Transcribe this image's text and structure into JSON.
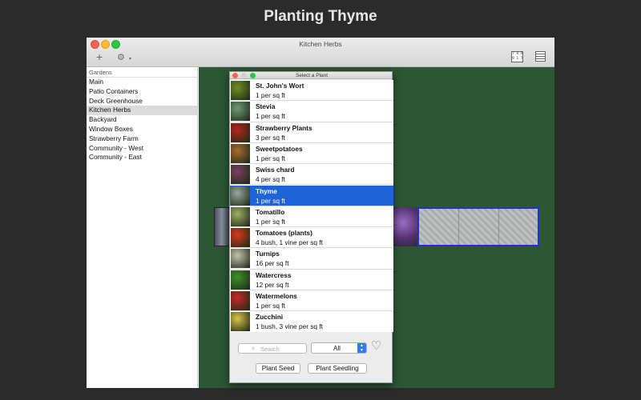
{
  "headline": "Planting Thyme",
  "window": {
    "title": "Kitchen Herbs",
    "toolbar": {
      "add_icon": "+",
      "gear_icon": "⚙",
      "gear_caret": "▾",
      "grid_icon_text": "7 4 9\n9 1 7"
    }
  },
  "sidebar": {
    "header": "Gardens",
    "items": [
      {
        "label": "Main"
      },
      {
        "label": "Patio Containers"
      },
      {
        "label": "Deck Greenhouse"
      },
      {
        "label": "Kitchen Herbs",
        "selected": true
      },
      {
        "label": "Backyard"
      },
      {
        "label": "Window Boxes"
      },
      {
        "label": "Strawberry Farm"
      },
      {
        "label": "Community - West"
      },
      {
        "label": "Community - East"
      }
    ]
  },
  "picker": {
    "title": "Select a Plant",
    "plants": [
      {
        "name": "St. John's Wort",
        "spacing": "1 per sq ft",
        "color": "#6f8e2a"
      },
      {
        "name": "Stevia",
        "spacing": "1 per sq ft",
        "color": "#6f9a78"
      },
      {
        "name": "Strawberry Plants",
        "spacing": "3 per sq ft",
        "color": "#b8241e"
      },
      {
        "name": "Sweetpotatoes",
        "spacing": "1 per sq ft",
        "color": "#a86a33"
      },
      {
        "name": "Swiss chard",
        "spacing": "4 per sq ft",
        "color": "#7a3f5f"
      },
      {
        "name": "Thyme",
        "spacing": "1 per sq ft",
        "color": "#9aa79b",
        "selected": true
      },
      {
        "name": "Tomatillo",
        "spacing": "1 per sq ft",
        "color": "#a3ad63"
      },
      {
        "name": "Tomatoes (plants)",
        "spacing": "4 bush, 1 vine per sq ft",
        "color": "#d9381e"
      },
      {
        "name": "Turnips",
        "spacing": "16 per sq ft",
        "color": "#c9c3b0"
      },
      {
        "name": "Watercress",
        "spacing": "12 per sq ft",
        "color": "#3e8f2d"
      },
      {
        "name": "Watermelons",
        "spacing": "1 per sq ft",
        "color": "#c72a2a"
      },
      {
        "name": "Zucchini",
        "spacing": "1 bush, 3 vine per sq ft",
        "color": "#d8c34a"
      }
    ],
    "search": {
      "placeholder": "Search",
      "value": ""
    },
    "filter": {
      "value": "All"
    },
    "buttons": {
      "plant_seed": "Plant Seed",
      "plant_seedling": "Plant Seedling"
    }
  },
  "colors": {
    "selection": "#1f63d9",
    "garden_bg": "#2d5634",
    "tile_border": "#1f2fd9"
  }
}
